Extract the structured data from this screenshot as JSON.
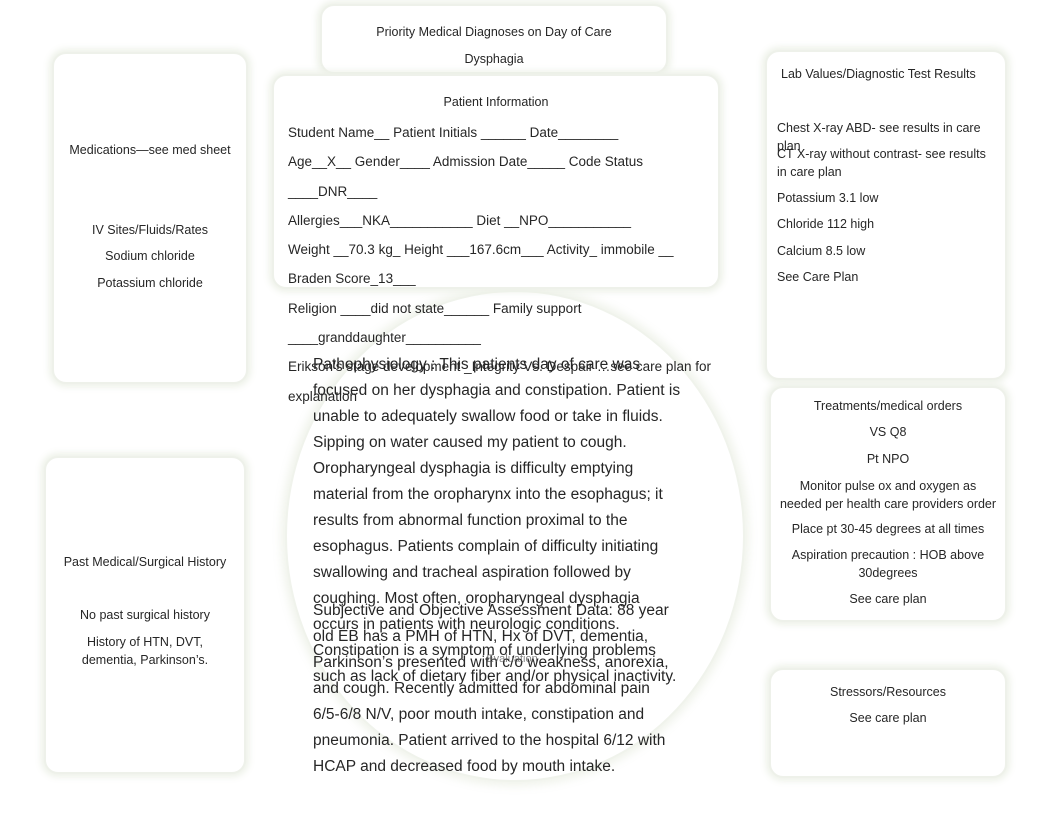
{
  "page": {
    "background_color": "#ffffff",
    "box_border_color": "#eef1ea",
    "text_color": "#262626"
  },
  "diagnoses_box": {
    "title": "Priority Medical Diagnoses on Day of Care",
    "diagnosis": "Dysphagia"
  },
  "patient_information": {
    "title": "Patient Information",
    "lines": [
      "Student Name__        Patient Initials ______      Date________",
      "Age__X__ Gender____  Admission Date_____  Code Status ____DNR____",
      "Allergies___NKA___________ Diet __NPO___________",
      "Weight __70.3 kg_ Height ___167.6cm___  Activity_ immobile __ Braden Score_13___",
      "Religion ____did not state______          Family support ____granddaughter__________",
      "Erikson’s stage development _Integrity Vs. Despair …see care plan for explanation"
    ]
  },
  "medications_box": {
    "title": "Medications—see med sheet",
    "iv_title": "IV Sites/Fluids/Rates",
    "iv_items": [
      "Sodium chloride",
      "Potassium chloride"
    ]
  },
  "history_box": {
    "title": "Past Medical/Surgical History",
    "items": [
      "No past surgical history",
      "History of HTN, DVT,\ndementia, Parkinson’s."
    ]
  },
  "labs_box": {
    "title": "Lab Values/Diagnostic Test Results",
    "items": [
      "Chest X-ray ABD- see results in care plan",
      "CT X-ray without contrast- see results in care plan",
      "Potassium 3.1 low",
      "Chloride 112 high",
      "Calcium 8.5 low",
      "See Care Plan"
    ]
  },
  "treatments_box": {
    "title": "Treatments/medical orders",
    "items": [
      "VS Q8",
      "Pt NPO",
      "Monitor pulse ox and oxygen as needed per health care providers order",
      "Place pt 30-45 degrees at all times",
      "Aspiration precaution : HOB above 30degrees",
      "See care plan"
    ]
  },
  "stressors_box": {
    "title": "Stressors/Resources",
    "items": [
      "See care plan"
    ]
  },
  "center_content": {
    "pathophysiology": "Pathophysiology : This patients day of care was focused on her dysphagia and constipation. Patient is unable to adequately swallow food or take in fluids. Sipping on water caused my patient to cough. Oropharyngeal dysphagia is difficulty emptying material from the oropharynx into the esophagus; it results from abnormal function proximal to the esophagus. Patients complain of difficulty initiating swallowing and tracheal aspiration followed by coughing. Most often, oropharyngeal dysphagia occurs in patients with neurologic conditions. Constipation is a symptom of underlying problems such as lack of dietary fiber and/or physical inactivity.",
    "assessment": "Subjective and Objective Assessment Data: 88 year old EB has a PMH of HTN, Hx of DVT, dementia, Parkinson’s presented with c/o weakness, anorexia, and cough. Recently admitted for abdominal pain 6/5-6/8 N/V, poor mouth intake, constipation and pneumonia. Patient arrived to the hospital 6/12 with HCAP and decreased food by mouth intake.",
    "overlay_label": "Evaluation"
  }
}
